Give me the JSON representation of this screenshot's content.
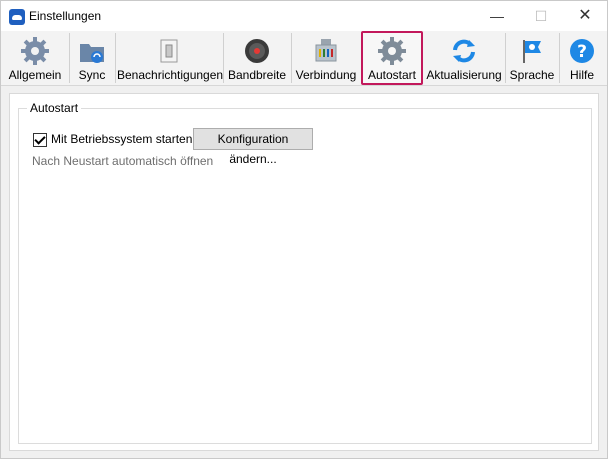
{
  "window": {
    "title": "Einstellungen",
    "minimize": "—",
    "maximize": "☐",
    "close": "✕"
  },
  "toolbar": {
    "tabs": [
      {
        "label": "Allgemein",
        "icon": "gear-icon"
      },
      {
        "label": "Sync",
        "icon": "sync-folder-icon"
      },
      {
        "label": "Benachrichtigungen",
        "icon": "toggle-switch-icon"
      },
      {
        "label": "Bandbreite",
        "icon": "gauge-icon"
      },
      {
        "label": "Verbindung",
        "icon": "network-connector-icon"
      },
      {
        "label": "Autostart",
        "icon": "gear-icon"
      },
      {
        "label": "Aktualisierung",
        "icon": "refresh-icon"
      },
      {
        "label": "Sprache",
        "icon": "flag-icon"
      },
      {
        "label": "Hilfe",
        "icon": "help-icon"
      }
    ],
    "active": "Autostart"
  },
  "autostart": {
    "group_title": "Autostart",
    "checkbox_label": "Mit Betriebssystem starten",
    "checked": true,
    "config_button": "Konfiguration ändern...",
    "hint": "Nach Neustart automatisch öffnen"
  },
  "colors": {
    "active_tab_border": "#c2185b",
    "brand": "#1f5fbf"
  }
}
